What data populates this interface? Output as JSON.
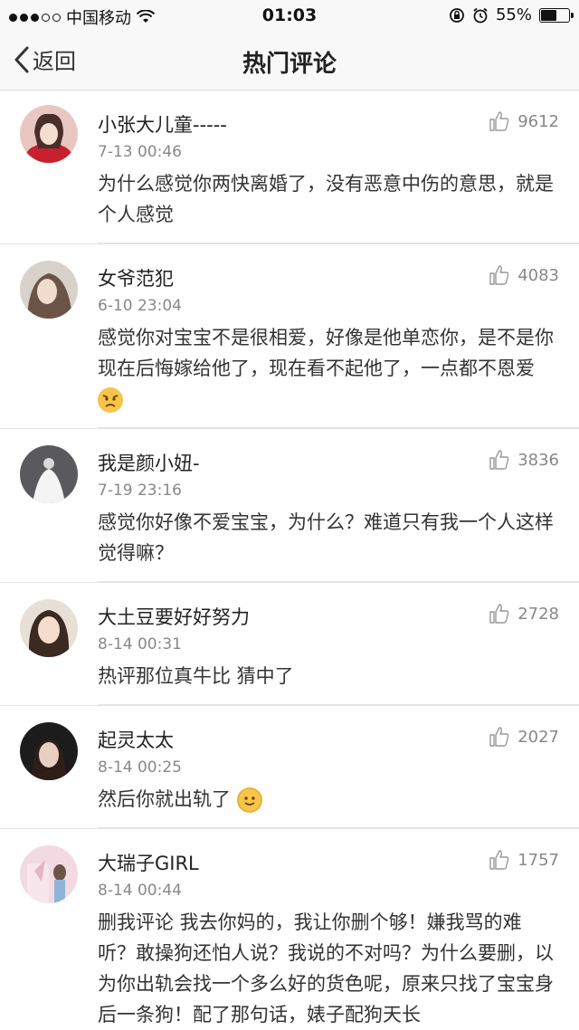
{
  "status_bar": {
    "carrier": "中国移动",
    "time": "01:03",
    "battery": "55%",
    "battery_level": 0.55
  },
  "nav": {
    "back_label": "返回",
    "title": "热门评论"
  },
  "comments": [
    {
      "name": "小张大儿童-----",
      "time": "7-13 00:46",
      "likes": "9612",
      "text": "为什么感觉你两快离婚了，没有恶意中伤的意思，就是个人感觉"
    },
    {
      "name": "女爷范犯",
      "time": "6-10 23:04",
      "likes": "4083",
      "text": "感觉你对宝宝不是很相爱，好像是他单恋你，是不是你现在后悔嫁给他了，现在看不起他了，一点都不恩爱"
    },
    {
      "name": "我是颜小妞-",
      "time": "7-19 23:16",
      "likes": "3836",
      "text": "感觉你好像不爱宝宝，为什么？难道只有我一个人这样觉得嘛？"
    },
    {
      "name": "大土豆要好好努力",
      "time": "8-14 00:31",
      "likes": "2728",
      "text": "热评那位真牛比 猜中了"
    },
    {
      "name": "起灵太太",
      "time": "8-14 00:25",
      "likes": "2027",
      "text": "然后你就出轨了"
    },
    {
      "name": "大瑞子GIRL",
      "time": "8-14 00:44",
      "likes": "1757",
      "text": "删我评论 我去你妈的，我让你删个够！嫌我骂的难听？敢操狗还怕人说？我说的不对吗？为什么要删，以为你出轨会找一个多么好的货色呢，原来只找了宝宝身后一条狗！配了那句话，婊子配狗天长"
    }
  ],
  "icons": {
    "like": "thumbs-up-icon",
    "back": "chevron-left-icon",
    "wifi": "wifi-icon",
    "lock": "rotation-lock-icon",
    "alarm": "alarm-icon",
    "angry": "angry-emoji-icon",
    "smile": "smile-emoji-icon"
  },
  "colors": {
    "text": "#333333",
    "secondary": "#888888",
    "bar_bg": "#f8f8f8",
    "divider": "#e4e4e4"
  }
}
